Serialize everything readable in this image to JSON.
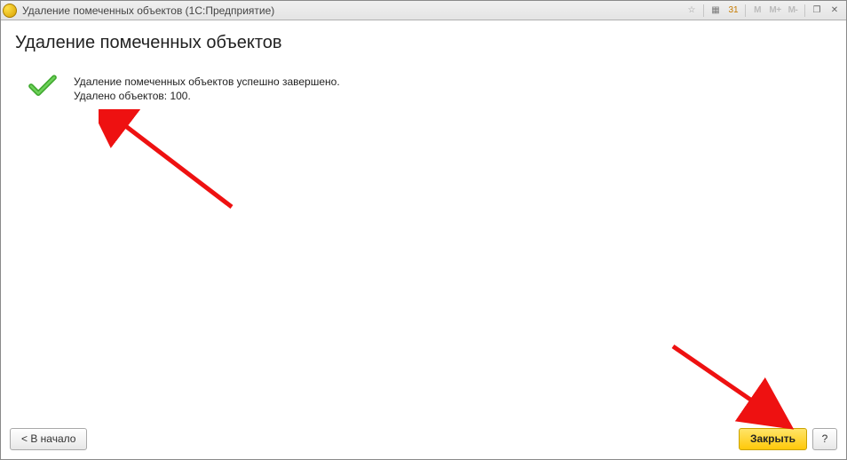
{
  "window": {
    "title": "Удаление помеченных объектов  (1С:Предприятие)"
  },
  "titlebar_buttons": {
    "favorite": "☆",
    "calculator": "▦",
    "calendar": "31",
    "m": "M",
    "m_plus": "M+",
    "m_minus": "M-",
    "maximize": "❐",
    "close": "✕"
  },
  "page": {
    "heading": "Удаление помеченных объектов",
    "success_line1": "Удаление помеченных объектов успешно завершено.",
    "success_line2": "Удалено объектов: 100."
  },
  "footer": {
    "back_label": "< В начало",
    "close_label": "Закрыть",
    "help_label": "?"
  }
}
